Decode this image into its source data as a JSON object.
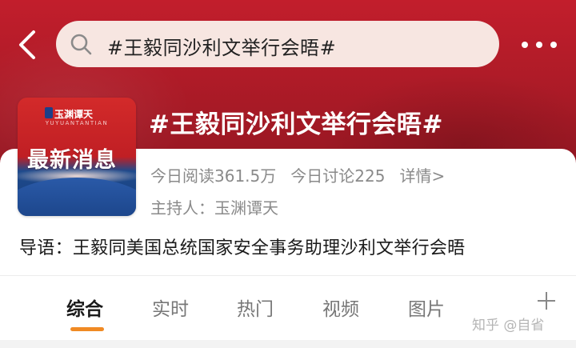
{
  "search": {
    "query": "#王毅同沙利文举行会晤#"
  },
  "topic": {
    "title": "#王毅同沙利文举行会晤#",
    "reads": "今日阅读361.5万",
    "discussions": "今日讨论225",
    "details_link": "详情>",
    "host": "主持人：玉渊谭天",
    "intro": "导语：王毅同美国总统国家安全事务助理沙利文举行会晤"
  },
  "thumbnail": {
    "logo_text": "玉渊谭天",
    "subtitle": "YUYUANTANTIAN",
    "headline": "最新消息"
  },
  "tabs": [
    {
      "label": "综合",
      "active": true
    },
    {
      "label": "实时",
      "active": false
    },
    {
      "label": "热门",
      "active": false
    },
    {
      "label": "视频",
      "active": false
    },
    {
      "label": "图片",
      "active": false
    }
  ],
  "watermark": "知乎 @自省",
  "colors": {
    "hero_red": "#c21e2c",
    "tab_accent": "#f08a24",
    "muted_text": "#8a8a8a"
  },
  "icons": {
    "back": "chevron-left-icon",
    "search": "search-icon",
    "more": "more-dots-icon",
    "add_tab": "plus-icon"
  }
}
